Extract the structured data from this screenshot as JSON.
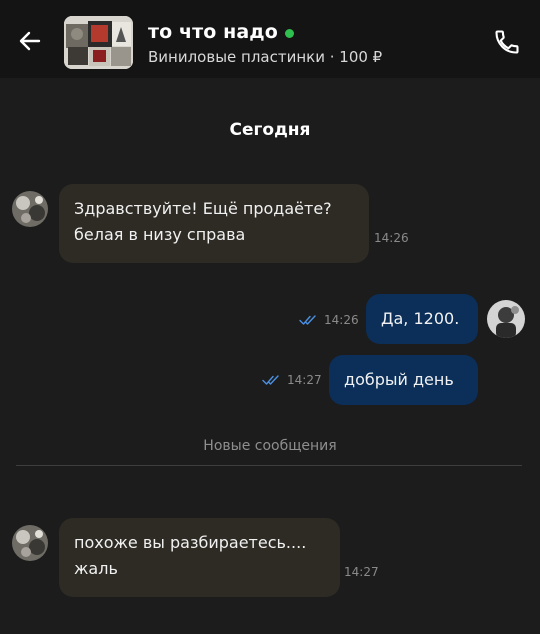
{
  "header": {
    "title": "то что надо",
    "online_color": "#2fbf4f",
    "subtitle": "Виниловые пластинки · 100 ₽",
    "back_icon": "arrow-left-icon",
    "call_icon": "phone-icon"
  },
  "chat": {
    "date_separator": "Сегодня",
    "new_messages_separator": "Новые сообщения",
    "messages": [
      {
        "direction": "incoming",
        "text": "Здравствуйте! Ещё продаёте?\nбелая в низу справа",
        "time": "14:26"
      },
      {
        "direction": "outgoing",
        "text": "Да, 1200.",
        "time": "14:26",
        "status": "read"
      },
      {
        "direction": "outgoing",
        "text": "добрый день",
        "time": "14:27",
        "status": "read"
      },
      {
        "direction": "incoming",
        "text": "похоже вы разбираетесь....\nжаль",
        "time": "14:27"
      }
    ]
  },
  "colors": {
    "incoming_bubble": "#2e2b25",
    "outgoing_bubble": "#0b2f59",
    "read_check": "#4a90e2"
  }
}
